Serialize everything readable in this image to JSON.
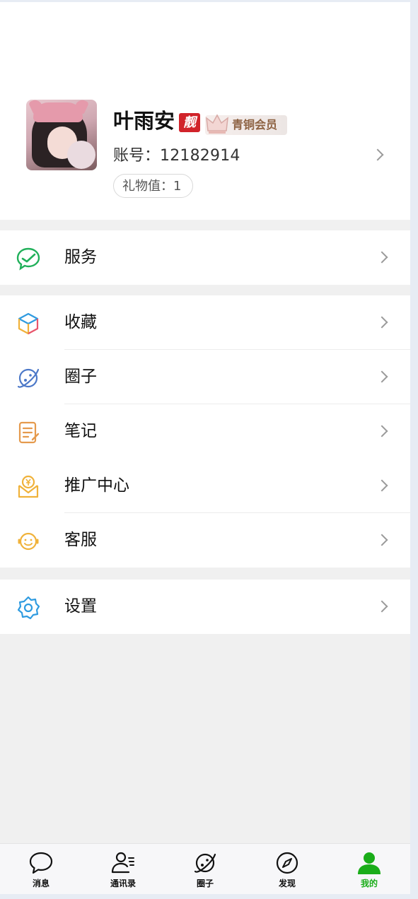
{
  "profile": {
    "name": "叶雨安",
    "pretty_badge": "靓",
    "member_level": "青铜会员",
    "account_label": "账号：",
    "account_value": "12182914",
    "gift_label": "礼物值：",
    "gift_value": "1"
  },
  "menu": {
    "service": "服务",
    "favorites": "收藏",
    "circle": "圈子",
    "notes": "笔记",
    "promotion": "推广中心",
    "customer_service": "客服",
    "settings": "设置"
  },
  "nav": {
    "messages": "消息",
    "contacts": "通讯录",
    "circle": "圈子",
    "discover": "发现",
    "me": "我的",
    "active_color": "#1aad19"
  },
  "colors": {
    "accent_green": "#1aad19",
    "badge_red": "#d1232a",
    "vip_text": "#8d6242"
  }
}
